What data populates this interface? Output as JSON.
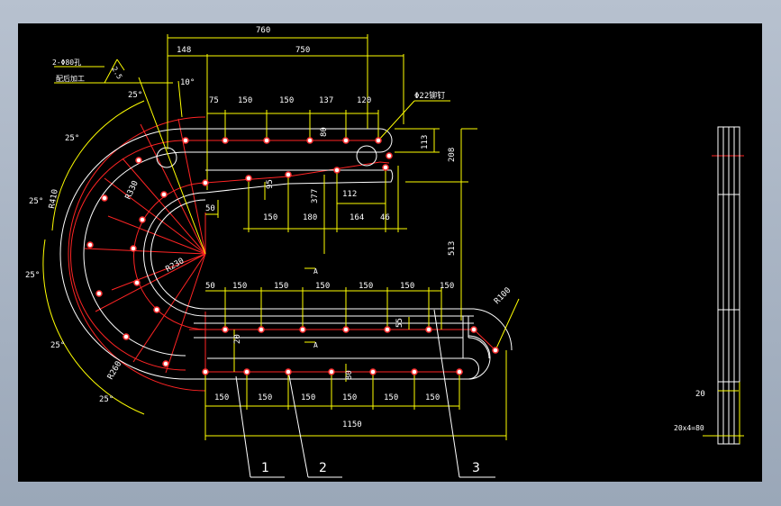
{
  "colors": {
    "background": "#000000",
    "outline": "#ffffff",
    "centerline": "#ff2020",
    "dimension": "#ffff00",
    "dimtext": "#ffffff",
    "hole": "#ff3030",
    "chrome": "#a9b4c4"
  },
  "notes": {
    "hole_spec": "2-Φ80孔",
    "hole_process": "配后加工",
    "roughness": "2.5",
    "rivet": "Φ22铆钉",
    "section": "A",
    "part_labels": [
      "1",
      "2",
      "3"
    ]
  },
  "angles": {
    "a10": "10°",
    "a25": "25°"
  },
  "radii": {
    "r_outer": "R410",
    "r_mid": "R330",
    "r_inner": "R230",
    "r_small": "R260",
    "r_end": "R100"
  },
  "dims": {
    "top_total": "760",
    "top_left": "148",
    "top_span": "750",
    "row1": [
      "75",
      "150",
      "150",
      "137",
      "120"
    ],
    "row2": [
      "150",
      "180",
      "164",
      "46"
    ],
    "v_113": "113",
    "v_208": "208",
    "v_377": "377",
    "v_112": "112",
    "v_50": "50",
    "v_95": "95",
    "v_80": "80",
    "v_513": "513",
    "mid_row": [
      "50",
      "150",
      "150",
      "150",
      "150",
      "150",
      "150"
    ],
    "bot_row": [
      "150",
      "150",
      "150",
      "150",
      "150",
      "150"
    ],
    "v_20": "20",
    "v_80b": "80",
    "v_55": "55",
    "overall": "1150",
    "side_20": "20",
    "side_total": "20x4=80"
  }
}
